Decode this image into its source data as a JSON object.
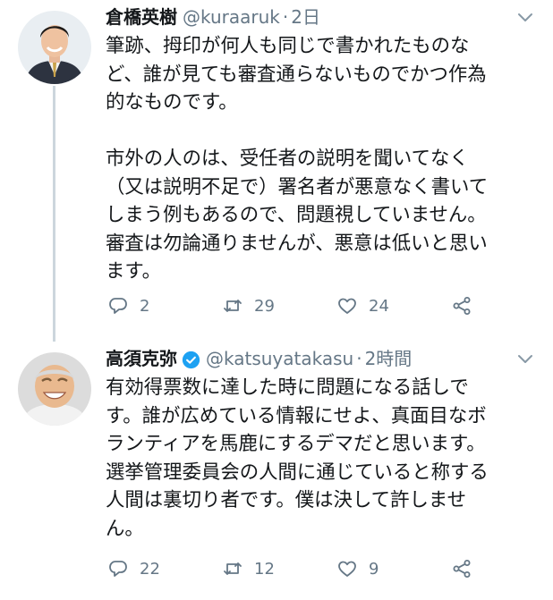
{
  "tweets": [
    {
      "name": "倉橋英樹",
      "handle": "@kuraaruk",
      "separator": "·",
      "time": "2日",
      "verified": false,
      "paragraphs": [
        "筆跡、拇印が何人も同じで書かれたものな\nど、誰が見ても審査通らないものでかつ作為\n的なものです。",
        "市外の人のは、受任者の説明を聞いてなく\n（又は説明不足で）署名者が悪意なく書いて\nしまう例もあるので、問題視していません。\n審査は勿論通りませんが、悪意は低いと思い\nます。"
      ],
      "actions": {
        "reply": "2",
        "retweet": "29",
        "like": "24"
      }
    },
    {
      "name": "高須克弥",
      "handle": "@katsuyatakasu",
      "separator": "·",
      "time": "2時間",
      "verified": true,
      "paragraphs": [
        "有効得票数に達した時に問題になる話しで\nす。誰が広めている情報にせよ、真面目なボ\nランティアを馬鹿にするデマだと思います。\n選挙管理委員会の人間に通じていると称する\n人間は裏切り者です。僕は決して許しませ\nん。"
      ],
      "actions": {
        "reply": "22",
        "retweet": "12",
        "like": "9"
      }
    }
  ],
  "colors": {
    "text": "#14171a",
    "secondary": "#657786",
    "thread_line": "#ccd6dd",
    "verified_badge": "#1da1f2"
  },
  "icons": [
    "reply-icon",
    "retweet-icon",
    "like-icon",
    "share-icon",
    "chevron-down-icon",
    "verified-badge-icon"
  ]
}
